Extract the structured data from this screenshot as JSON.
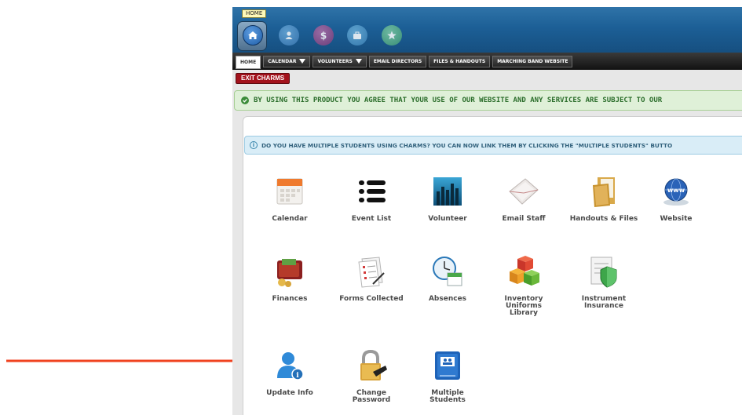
{
  "topbar": {
    "home_tooltip": "HOME"
  },
  "menubar": {
    "tabs": [
      {
        "label": "HOME"
      },
      {
        "label": "CALENDAR"
      },
      {
        "label": "VOLUNTEERS"
      },
      {
        "label": "EMAIL DIRECTORS"
      },
      {
        "label": "FILES & HANDOUTS"
      },
      {
        "label": "MARCHING BAND WEBSITE"
      }
    ]
  },
  "exit_label": "EXIT CHARMS",
  "agreement_text": "BY USING THIS PRODUCT YOU AGREE THAT YOUR USE OF OUR WEBSITE AND ANY SERVICES ARE SUBJECT TO OUR",
  "info_text": "DO YOU HAVE MULTIPLE STUDENTS USING CHARMS? YOU CAN NOW LINK THEM BY CLICKING THE \"MULTIPLE STUDENTS\" BUTTO",
  "tiles": {
    "row1": [
      {
        "label": "Calendar",
        "icon": "calendar-icon"
      },
      {
        "label": "Event List",
        "icon": "list-icon"
      },
      {
        "label": "Volunteer",
        "icon": "volunteer-icon"
      },
      {
        "label": "Email Staff",
        "icon": "envelope-icon"
      },
      {
        "label": "Handouts & Files",
        "icon": "folder-icon"
      },
      {
        "label": "Website",
        "icon": "globe-icon"
      }
    ],
    "row2": [
      {
        "label": "Finances",
        "icon": "wallet-icon"
      },
      {
        "label": "Forms Collected",
        "icon": "forms-icon"
      },
      {
        "label": "Absences",
        "icon": "clock-icon"
      },
      {
        "label": "Inventory\nUniforms\nLibrary",
        "icon": "cubes-icon"
      },
      {
        "label": "Instrument\nInsurance",
        "icon": "insurance-shield-icon"
      }
    ],
    "row3": [
      {
        "label": "Update Info",
        "icon": "user-info-icon"
      },
      {
        "label": "Change\nPassword",
        "icon": "padlock-icon"
      },
      {
        "label": "Multiple\nStudents",
        "icon": "students-icon"
      }
    ]
  },
  "colors": {
    "arrow": "#f0421f",
    "exit_button": "#a3121c",
    "agree_bg": "#dff0d8",
    "info_bg": "#d9edf7"
  }
}
